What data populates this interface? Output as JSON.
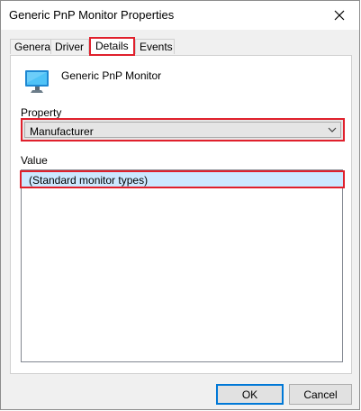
{
  "window": {
    "title": "Generic PnP Monitor Properties"
  },
  "tabs": [
    {
      "label": "General",
      "active": false
    },
    {
      "label": "Driver",
      "active": false
    },
    {
      "label": "Details",
      "active": true
    },
    {
      "label": "Events",
      "active": false
    }
  ],
  "device": {
    "name": "Generic PnP Monitor",
    "icon": "monitor-icon"
  },
  "details": {
    "property_label": "Property",
    "property_selected": "Manufacturer",
    "value_label": "Value",
    "values": [
      "(Standard monitor types)"
    ]
  },
  "buttons": {
    "ok": "OK",
    "cancel": "Cancel"
  },
  "colors": {
    "highlight_border": "#e0202c",
    "selected_row": "#cce8ff",
    "ok_border": "#0078d7"
  }
}
